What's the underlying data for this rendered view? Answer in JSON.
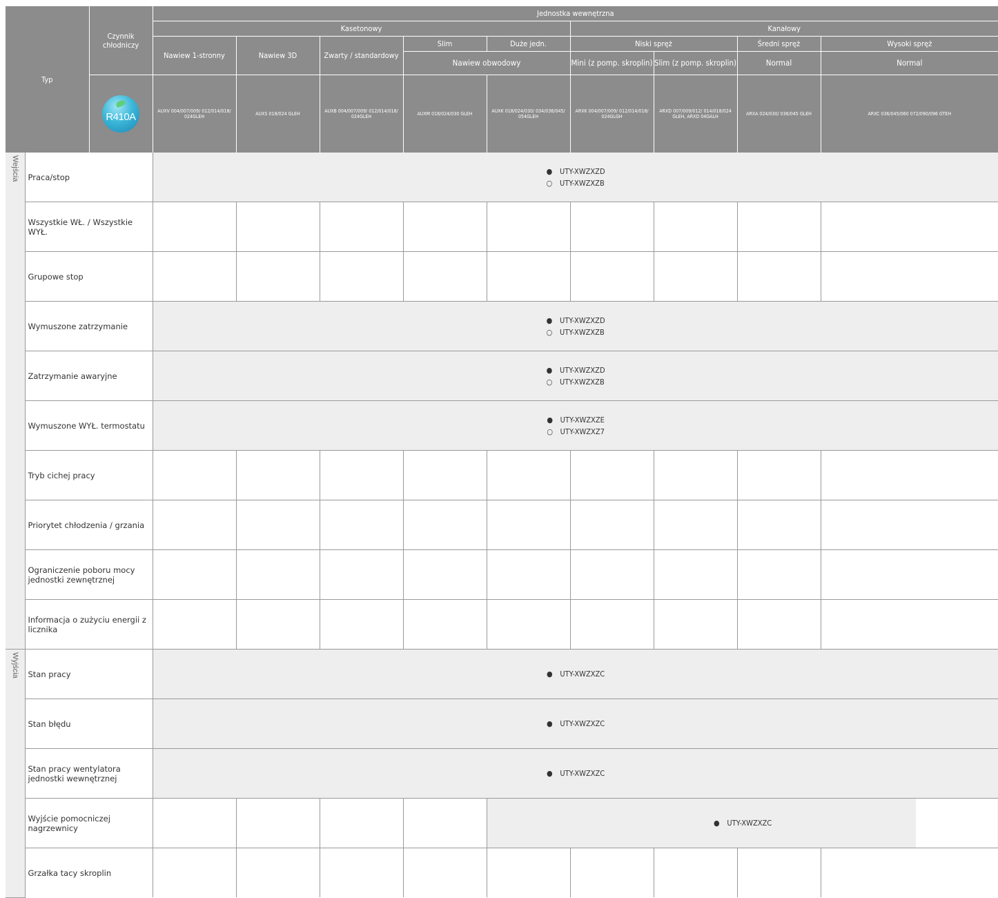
{
  "page": {
    "header": {
      "indoor_unit": "Jednostka wewnętrzna",
      "czynnik": "Czynnik chłodniczy",
      "typ": "Typ",
      "kasetonowy": "Kasetonowy",
      "kanalowy": "Kanałowy",
      "nawiew1": "Nawiew 1-stronny",
      "nawiew3d": "Nawiew 3D",
      "zwarty": "Zwarty / standardowy",
      "slim": "Slim",
      "duze": "Duże jedn.",
      "nawiew_obw": "Nawiew obwodowy",
      "niski": "Niski spręż",
      "sredni": "Średni spręż",
      "wysoki": "Wysoki spręż",
      "mini": "Mini (z pomp. skroplin)",
      "slim_kanal": "Slim (z pomp. skroplin)",
      "normal1": "Normal",
      "normal2": "Normal",
      "logo_text": "R410A",
      "models": [
        "AUXV 004/007/009/ 012/014/018/ 024GLEH",
        "AUXS 018/024 GLEH",
        "AUXB 004/007/009/ 012/014/018/ 024GLEH",
        "AUXM 018/024/030 GLEH",
        "AUXK 018/024/030/ 034/036/045/ 054GLEH",
        "ARXK 004/007/009/ 012/014/018/ 024GLGH",
        "ARXD 007/009/012/ 014/018/024 GLEH, ARXD 04GALH",
        "ARXA 024/030/ 036/045 GLEH",
        "ARXC 036/045/060 072/090/096 GTEH"
      ]
    },
    "sections": {
      "inputs": "Wejścia",
      "outputs": "Wyjścia"
    },
    "rows": [
      {
        "label": "Praca/stop",
        "filled": "UTY-XWZXZD",
        "open": "UTY-XWZXZB"
      },
      {
        "label": "Wszystkie WŁ. / Wszystkie WYŁ."
      },
      {
        "label": "Grupowe stop"
      },
      {
        "label": "Wymuszone zatrzymanie",
        "filled": "UTY-XWZXZD",
        "open": "UTY-XWZXZB"
      },
      {
        "label": "Zatrzymanie awaryjne",
        "filled": "UTY-XWZXZD",
        "open": "UTY-XWZXZB"
      },
      {
        "label": "Wymuszone WYŁ. termostatu",
        "filled": "UTY-XWZXZE",
        "open": "UTY-XWZXZ7"
      },
      {
        "label": "Tryb cichej pracy"
      },
      {
        "label": "Priorytet chłodzenia / grzania"
      },
      {
        "label": "Ograniczenie poboru mocy jednostki zewnętrznej"
      },
      {
        "label": "Informacja o zużyciu energii z licznika"
      },
      {
        "label": "Stan pracy",
        "filled": "UTY-XWZXZC"
      },
      {
        "label": "Stan błędu",
        "filled": "UTY-XWZXZC"
      },
      {
        "label": "Stan pracy wentylatora jednostki wewnętrznej",
        "filled": "UTY-XWZXZC"
      },
      {
        "label": "Wyjście pomocniczej nagrzewnicy",
        "filled": "UTY-XWZXZC"
      },
      {
        "label": "Grzałka tacy skroplin"
      }
    ],
    "symbols": {
      "filled": "●",
      "open": "○"
    }
  }
}
